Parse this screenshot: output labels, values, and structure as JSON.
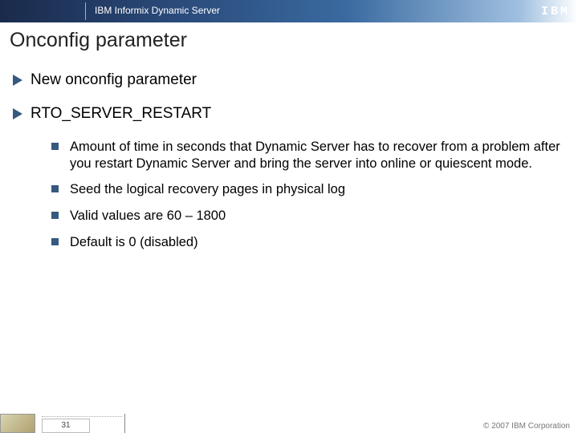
{
  "header": {
    "product": "IBM Informix Dynamic Server",
    "logo": "IBM"
  },
  "title": "Onconfig parameter",
  "bullets_level1": [
    {
      "text": "New onconfig parameter"
    },
    {
      "text": "RTO_SERVER_RESTART"
    }
  ],
  "bullets_level2": [
    {
      "text": "Amount of time in seconds that Dynamic Server has to recover from a problem after you restart Dynamic Server and bring the server into online or quiescent mode."
    },
    {
      "text": "Seed the logical recovery pages in physical log"
    },
    {
      "text": "Valid values are 60 – 1800"
    },
    {
      "text": "Default is 0 (disabled)"
    }
  ],
  "footer": {
    "page": "31",
    "copyright": "© 2007 IBM Corporation"
  }
}
